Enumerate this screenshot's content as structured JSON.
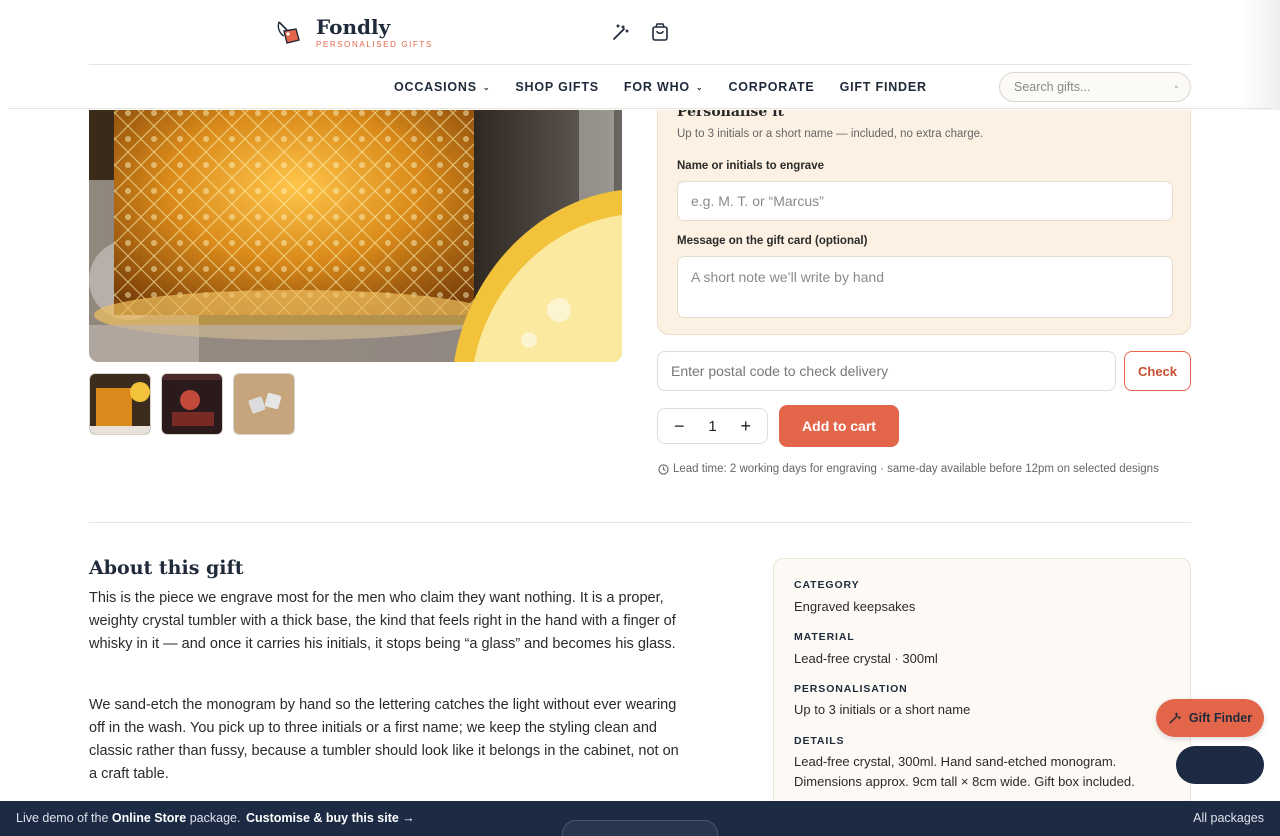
{
  "brand": {
    "name": "Fondly",
    "tagline": "PERSONALISED GIFTS"
  },
  "header": {
    "icons": [
      "magic-wand-icon",
      "shopping-bag-icon"
    ]
  },
  "nav": [
    {
      "label": "OCCASIONS",
      "dropdown": true
    },
    {
      "label": "SHOP GIFTS",
      "dropdown": false
    },
    {
      "label": "FOR WHO",
      "dropdown": true
    },
    {
      "label": "CORPORATE",
      "dropdown": false
    },
    {
      "label": "GIFT FINDER",
      "dropdown": false
    }
  ],
  "search": {
    "placeholder": "Search gifts..."
  },
  "personalise": {
    "title": "Personalise it",
    "subtitle": "Up to 3 initials or a short name — included, no extra charge.",
    "name_label": "Name or initials to engrave",
    "name_placeholder": "e.g. M. T. or “Marcus”",
    "message_label": "Message on the gift card (optional)",
    "message_placeholder": "A short note we’ll write by hand"
  },
  "delivery": {
    "postal_placeholder": "Enter postal code to check delivery",
    "check_label": "Check"
  },
  "purchase": {
    "quantity": "1",
    "minus": "−",
    "plus": "+",
    "add_label": "Add to cart"
  },
  "lead_time": "Lead time: 2 working days for engraving · same-day available before 12pm on selected designs",
  "about": {
    "title": "About this gift",
    "p1": "This is the piece we engrave most for the men who claim they want nothing. It is a proper, weighty crystal tumbler with a thick base, the kind that feels right in the hand with a finger of whisky in it — and once it carries his initials, it stops being “a glass” and becomes his glass.",
    "p2": "We sand-etch the monogram by hand so the lettering catches the light without ever wearing off in the wash. You pick up to three initials or a first name; we keep the styling clean and classic rather than fussy, because a tumbler should look like it belongs in the cabinet, not on a craft table."
  },
  "details": {
    "category_label": "CATEGORY",
    "category": "Engraved keepsakes",
    "material_label": "MATERIAL",
    "material": "Lead-free crystal · 300ml",
    "personalisation_label": "PERSONALISATION",
    "personalisation": "Up to 3 initials or a short name",
    "details_label": "DETAILS",
    "details": "Lead-free crystal, 300ml. Hand sand-etched monogram. Dimensions approx. 9cm tall × 8cm wide. Gift box included."
  },
  "floating": {
    "gift_finder_label": "Gift Finder"
  },
  "bottom_bar": {
    "prefix": "Live demo of the ",
    "package": "Online Store",
    "suffix": " package.",
    "cta": "Customise & buy this site →",
    "all": "All packages"
  },
  "colors": {
    "accent": "#e4664a",
    "navy": "#1c2a44",
    "panel": "#fcf1e2"
  }
}
